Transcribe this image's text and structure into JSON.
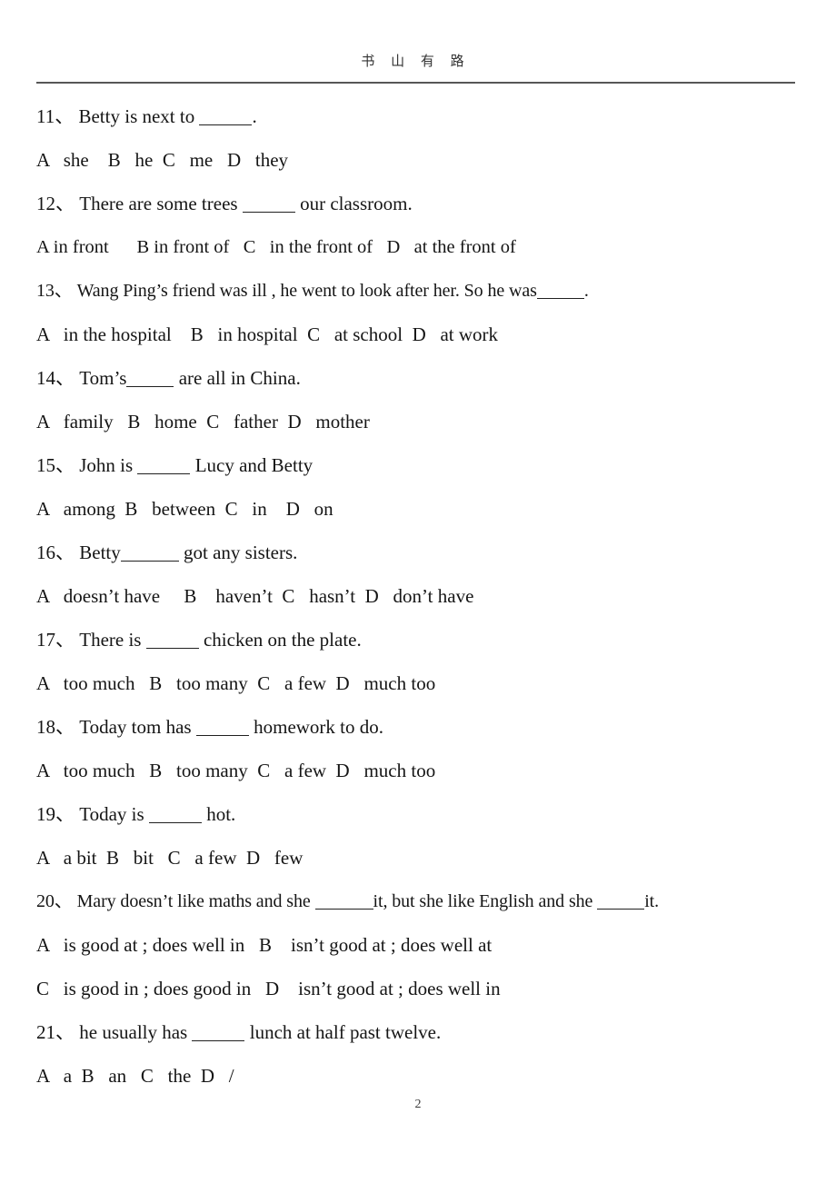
{
  "header": {
    "title": "书 山 有 路"
  },
  "footer": {
    "page_number": "2"
  },
  "questions": [
    {
      "number": "11、",
      "stem_before": " Betty is next to ",
      "stem_after": ".",
      "options_line": "A   she    B   he  C   me   D   they"
    },
    {
      "number": "12、",
      "stem_before": " There are some trees ",
      "stem_after": " our classroom.",
      "options_line": "A in front      B in front of   C   in the front of   D   at the front of"
    },
    {
      "number": "13、",
      "stem_before": " Wang Ping’s friend was ill , he went to look after her. So he was",
      "stem_after": ".",
      "options_line": "A   in the hospital    B   in hospital  C   at school  D   at work"
    },
    {
      "number": "14、",
      "stem_before": " Tom’s",
      "stem_after": " are all in China.",
      "options_line": "A   family   B   home  C   father  D   mother"
    },
    {
      "number": "15、",
      "stem_before": " John is ",
      "stem_after": " Lucy and Betty",
      "options_line": "A   among  B   between  C   in    D   on"
    },
    {
      "number": "16、",
      "stem_before": " Betty",
      "stem_after": " got any sisters.",
      "options_line": "A   doesn’t have     B    haven’t  C   hasn’t  D   don’t have"
    },
    {
      "number": "17、",
      "stem_before": " There is ",
      "stem_after": " chicken on the plate.",
      "options_line": "A   too much   B   too many  C   a few  D   much too"
    },
    {
      "number": "18、",
      "stem_before": " Today tom has ",
      "stem_after": " homework to do.",
      "options_line": "A   too much   B   too many  C   a few  D   much too"
    },
    {
      "number": "19、",
      "stem_before": " Today is ",
      "stem_after": " hot.",
      "options_line": "A   a bit  B   bit   C   a few  D   few"
    },
    {
      "number": "20、",
      "stem_before": " Mary doesn’t like maths and she ",
      "stem_middle": "it, but she like English and she ",
      "stem_after": "it.",
      "options_line_1": "A   is good at ; does well in   B    isn’t good at ; does well at",
      "options_line_2": "C   is good in ; does good in   D    isn’t good at ; does well in"
    },
    {
      "number": "21、",
      "stem_before": " he usually has ",
      "stem_after": " lunch at half past twelve.",
      "options_line": "A   a  B   an   C   the  D   /"
    }
  ]
}
